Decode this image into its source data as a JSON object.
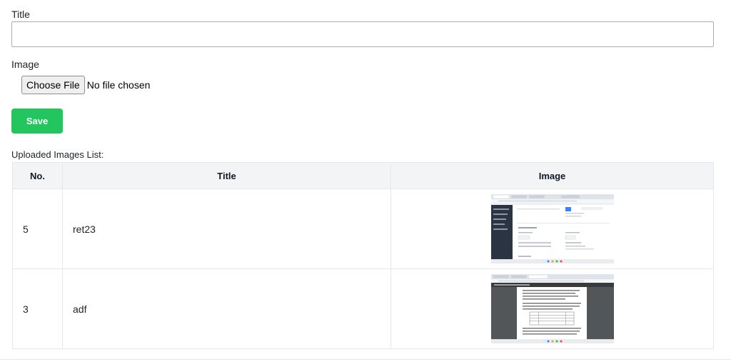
{
  "form": {
    "title_label": "Title",
    "title_value": "",
    "title_placeholder": "",
    "image_label": "Image",
    "choose_file_label": "Choose File",
    "file_status": "No file chosen",
    "save_label": "Save"
  },
  "list": {
    "heading": "Uploaded Images List:",
    "columns": {
      "no": "No.",
      "title": "Title",
      "image": "Image"
    },
    "rows": [
      {
        "no": "5",
        "title": "ret23",
        "thumbnail": "screenshot-thumbnail-dashboard"
      },
      {
        "no": "3",
        "title": "adf",
        "thumbnail": "screenshot-thumbnail-document"
      }
    ]
  },
  "colors": {
    "save_button": "#22c55e",
    "table_header_bg": "#f3f4f6",
    "border": "#e5e7eb"
  }
}
